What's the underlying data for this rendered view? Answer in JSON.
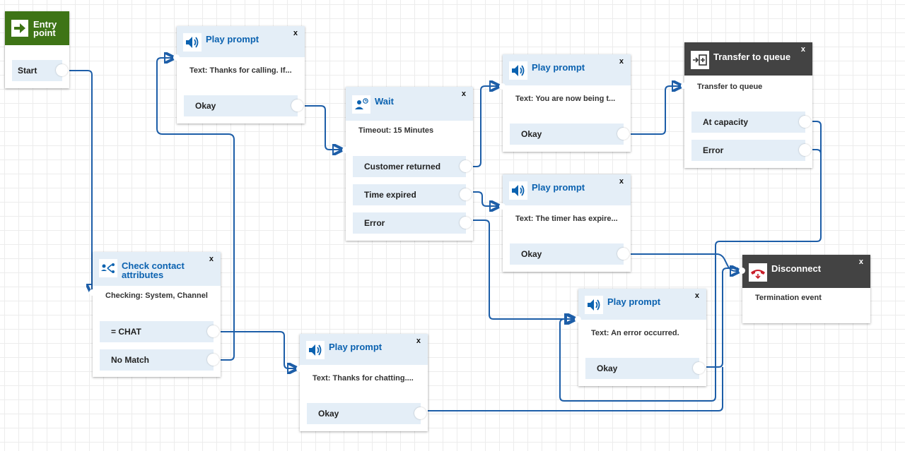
{
  "entry": {
    "title": "Entry point",
    "branch": "Start"
  },
  "check": {
    "title": "Check contact attributes",
    "desc": "Checking: System, Channel",
    "branches": [
      "= CHAT",
      "No Match"
    ]
  },
  "play_calling": {
    "title": "Play prompt",
    "desc": "Text: Thanks for calling. If...",
    "branch": "Okay"
  },
  "wait": {
    "title": "Wait",
    "desc": "Timeout: 15 Minutes",
    "branches": [
      "Customer returned",
      "Time expired",
      "Error"
    ]
  },
  "play_transfer": {
    "title": "Play prompt",
    "desc": "Text: You are now being t...",
    "branch": "Okay"
  },
  "play_timer": {
    "title": "Play prompt",
    "desc": "Text: The timer has expire...",
    "branch": "Okay"
  },
  "play_error": {
    "title": "Play prompt",
    "desc": "Text: An error occurred.",
    "branch": "Okay"
  },
  "play_chatting": {
    "title": "Play prompt",
    "desc": "Text: Thanks for chatting....",
    "branch": "Okay"
  },
  "transfer": {
    "title": "Transfer to queue",
    "desc": "Transfer to queue",
    "branches": [
      "At capacity",
      "Error"
    ]
  },
  "disconnect": {
    "title": "Disconnect",
    "desc": "Termination event"
  },
  "close_glyph": "x",
  "icons": {
    "entry": "arrow-right-icon",
    "play": "speaker-icon",
    "wait": "person-clock-icon",
    "check": "branch-network-icon",
    "transfer": "queue-transfer-icon",
    "disconnect": "phone-hangup-icon"
  },
  "colors": {
    "wire": "#1d5ea8",
    "entry_header": "#3e7416",
    "dark_header": "#434343",
    "title_blue": "#0b62b0",
    "block_header": "#e4eef7"
  }
}
